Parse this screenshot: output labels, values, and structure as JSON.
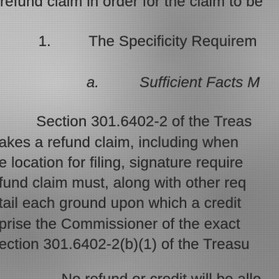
{
  "document": {
    "line_top": "refund claim in order for the claim to be",
    "section_number": "1.",
    "section_heading": "The Specificity Requirem",
    "subsection_letter": "a.",
    "subsection_heading": "Sufficient Facts M",
    "paragraph": [
      "Section 301.6402-2 of the Treas",
      "akes a refund claim, including when",
      "e location for filing, signature require",
      "fund claim must, along with other req",
      "tail each ground upon which a credit",
      "prise the Commissioner of the exact",
      "ection 301.6402-2(b)(1) of the Treasu"
    ],
    "line_bottom": "No refund or credit will be allo"
  }
}
